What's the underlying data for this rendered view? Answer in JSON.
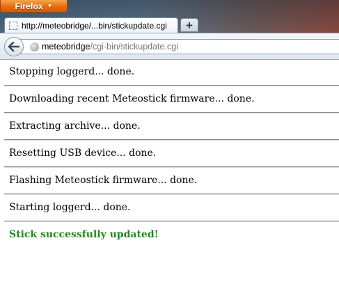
{
  "browser": {
    "app_button_label": "Firefox",
    "tab_title": "http://meteobridge/...bin/stickupdate.cgi",
    "new_tab_label": "+",
    "url_host": "meteobridge",
    "url_path": "/cgi-bin/stickupdate.cgi",
    "icons": {
      "back": "back-arrow-icon",
      "site": "globe-icon",
      "tab": "page-icon"
    }
  },
  "page": {
    "lines": [
      "Stopping loggerd... done.",
      "Downloading recent Meteostick firmware... done.",
      "Extracting archive... done.",
      "Resetting USB device... done.",
      "Flashing Meteostick firmware... done.",
      "Starting loggerd... done."
    ],
    "success_message": "Stick successfully updated!",
    "success_color": "#1f8a1f"
  }
}
